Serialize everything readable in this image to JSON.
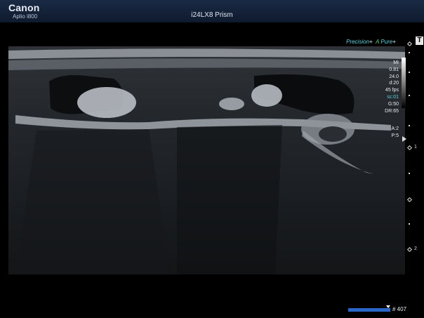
{
  "header": {
    "brand": "Canon",
    "model": "Aplio i800",
    "probe": "i24LX8 Prism"
  },
  "modes": {
    "precision": "Precision",
    "precision_symbol": "+",
    "pure_a": "A",
    "pure": "Pure",
    "pure_symbol": "+",
    "t_badge": "T"
  },
  "params": {
    "mi": "MI",
    "tis": "0.81",
    "depth_mhz": "24.0",
    "depth_cm": "d:20",
    "fps": "45 fps",
    "scan": "sc:01",
    "gain": "G:50",
    "dr": "DR:65",
    "a": "A:2",
    "p": "P:5"
  },
  "depth_scale": {
    "label_1": "1",
    "label_2": "2"
  },
  "cine": {
    "frame": "# 407",
    "progress": 0.92
  },
  "colors": {
    "accent_cyan": "#5fd0e0",
    "accent_green": "#58d06a",
    "header_bg": "#1a2a44",
    "progress_blue": "#2a66c8"
  }
}
